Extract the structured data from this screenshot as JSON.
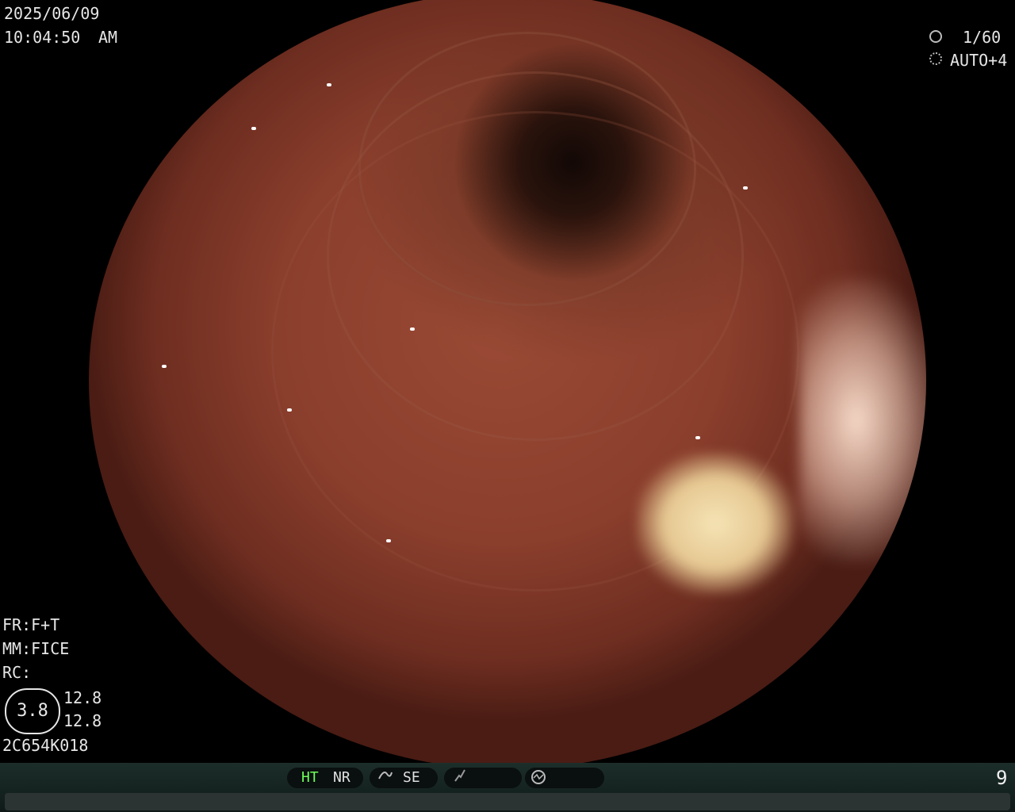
{
  "osd": {
    "date": "2025/06/09",
    "time": "10:04:50",
    "ampm": "AM",
    "shutter": "1/60",
    "iris": "AUTO+4",
    "fr": "FR:F+T",
    "mm": "MM:FICE",
    "rc": "RC:",
    "scope_value": "3.8",
    "val_top": "12.8",
    "val_bottom": "12.8",
    "serial": "2C654K018"
  },
  "statusbar": {
    "ht": "HT",
    "nr": "NR",
    "se": "SE",
    "counter": "9",
    "ht_color": "#6dff5a"
  },
  "icons": {
    "shutter": "shutter-aperture-icon",
    "iris": "iris-icon",
    "se": "se-curve-icon",
    "structure": "structure-enhance-icon",
    "color": "color-tone-icon"
  }
}
